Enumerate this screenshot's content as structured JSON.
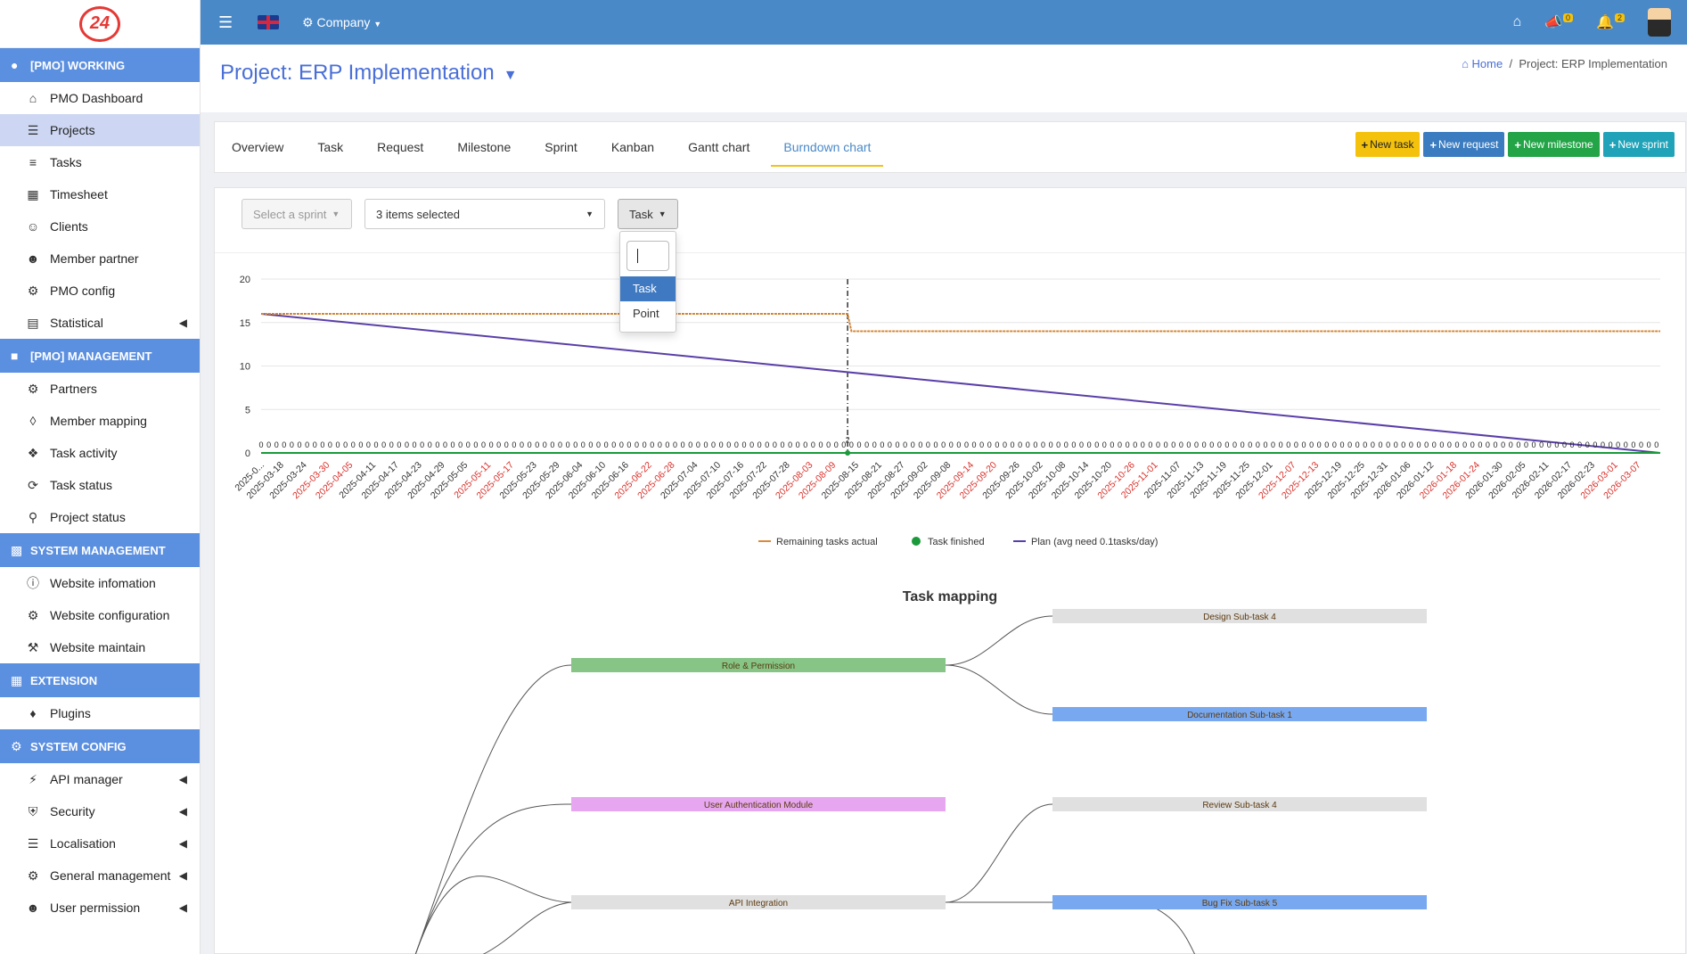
{
  "sidebar": {
    "logo": "24",
    "sections": [
      {
        "title": "[PMO] WORKING",
        "icon": "group-icon",
        "items": [
          {
            "label": "PMO Dashboard",
            "icon": "home-icon"
          },
          {
            "label": "Projects",
            "icon": "layers-icon",
            "active": true
          },
          {
            "label": "Tasks",
            "icon": "list-icon"
          },
          {
            "label": "Timesheet",
            "icon": "grid-icon"
          },
          {
            "label": "Clients",
            "icon": "user-icon"
          },
          {
            "label": "Member partner",
            "icon": "users-icon"
          },
          {
            "label": "PMO config",
            "icon": "gear-icon"
          },
          {
            "label": "Statistical",
            "icon": "chart-icon",
            "chevron": true
          }
        ]
      },
      {
        "title": "[PMO] MANAGEMENT",
        "icon": "building-icon",
        "items": [
          {
            "label": "Partners",
            "icon": "gear-icon"
          },
          {
            "label": "Member mapping",
            "icon": "sitemap-icon"
          },
          {
            "label": "Task activity",
            "icon": "network-icon"
          },
          {
            "label": "Task status",
            "icon": "status-icon"
          },
          {
            "label": "Project status",
            "icon": "pin-icon"
          }
        ]
      },
      {
        "title": "SYSTEM MANAGEMENT",
        "icon": "monitor-icon",
        "items": [
          {
            "label": "Website infomation",
            "icon": "info-icon"
          },
          {
            "label": "Website configuration",
            "icon": "gear-icon"
          },
          {
            "label": "Website maintain",
            "icon": "wrench-icon"
          }
        ]
      },
      {
        "title": "EXTENSION",
        "icon": "grid-icon",
        "items": [
          {
            "label": "Plugins",
            "icon": "puzzle-icon"
          }
        ]
      },
      {
        "title": "SYSTEM CONFIG",
        "icon": "gears-icon",
        "items": [
          {
            "label": "API manager",
            "icon": "plug-icon",
            "chevron": true
          },
          {
            "label": "Security",
            "icon": "shield-icon",
            "chevron": true
          },
          {
            "label": "Localisation",
            "icon": "sign-icon",
            "chevron": true
          },
          {
            "label": "General management",
            "icon": "cog-icon",
            "chevron": true
          },
          {
            "label": "User permission",
            "icon": "users-gear-icon",
            "chevron": true
          }
        ]
      }
    ]
  },
  "topbar": {
    "company": "Company",
    "announcements_count": "0",
    "notifications_count": "2"
  },
  "header": {
    "title": "Project: ERP Implementation",
    "breadcrumb_home": "Home",
    "breadcrumb_current": "Project: ERP Implementation"
  },
  "tabs": [
    "Overview",
    "Task",
    "Request",
    "Milestone",
    "Sprint",
    "Kanban",
    "Gantt chart",
    "Burndown chart"
  ],
  "active_tab": "Burndown chart",
  "actions": {
    "new_task": "New task",
    "new_request": "New request",
    "new_milestone": "New milestone",
    "new_sprint": "New sprint"
  },
  "filters": {
    "sprint_placeholder": "Select a sprint",
    "items_selected": "3 items selected",
    "mode": "Task",
    "options": [
      "Task",
      "Point"
    ]
  },
  "colors": {
    "remaining": "#d88b3a",
    "finished": "#1a9a3a",
    "plan": "#5a3fa8",
    "weekend_label": "#d9312b"
  },
  "chart_data": [
    {
      "type": "line",
      "title": "",
      "xlabel": "",
      "ylabel": "",
      "ylim": [
        0,
        20
      ],
      "yticks": [
        0,
        5,
        10,
        15,
        20
      ],
      "x_start": "2025-03-12",
      "x_end": "2026-03-12",
      "x_tick_labels": [
        "2025-0...",
        "2025-03-18",
        "2025-03-24",
        "2025-03-30",
        "2025-04-05",
        "2025-04-11",
        "2025-04-17",
        "2025-04-23",
        "2025-04-29",
        "2025-05-05",
        "2025-05-11",
        "2025-05-17",
        "2025-05-23",
        "2025-05-29",
        "2025-06-04",
        "2025-06-10",
        "2025-06-16",
        "2025-06-22",
        "2025-06-28",
        "2025-07-04",
        "2025-07-10",
        "2025-07-16",
        "2025-07-22",
        "2025-07-28",
        "2025-08-03",
        "2025-08-09",
        "2025-08-15",
        "2025-08-21",
        "2025-08-27",
        "2025-09-02",
        "2025-09-08",
        "2025-09-14",
        "2025-09-20",
        "2025-09-26",
        "2025-10-02",
        "2025-10-08",
        "2025-10-14",
        "2025-10-20",
        "2025-10-26",
        "2025-11-01",
        "2025-11-07",
        "2025-11-13",
        "2025-11-19",
        "2025-11-25",
        "2025-12-01",
        "2025-12-07",
        "2025-12-13",
        "2025-12-19",
        "2025-12-25",
        "2025-12-31",
        "2026-01-06",
        "2026-01-12",
        "2026-01-18",
        "2026-01-24",
        "2026-01-30",
        "2026-02-05",
        "2026-02-11",
        "2026-02-17",
        "2026-02-23",
        "2026-03-01",
        "2026-03-07"
      ],
      "weekend_ticks": [
        "2025-03-30",
        "2025-04-05",
        "2025-05-11",
        "2025-05-17",
        "2025-06-22",
        "2025-06-28",
        "2025-08-03",
        "2025-08-09",
        "2025-09-14",
        "2025-09-20",
        "2025-10-26",
        "2025-11-01",
        "2025-12-07",
        "2025-12-13",
        "2026-01-18",
        "2026-01-24",
        "2026-03-01",
        "2026-03-07"
      ],
      "today": "2025-08-12",
      "today_label": "2",
      "finished_label": "0",
      "series": [
        {
          "name": "Remaining tasks actual",
          "points": [
            [
              "2025-03-12",
              16
            ],
            [
              "2025-08-12",
              16
            ],
            [
              "2025-08-13",
              14
            ],
            [
              "2026-03-12",
              14
            ]
          ]
        },
        {
          "name": "Task finished",
          "points": [
            [
              "2025-03-12",
              0
            ],
            [
              "2026-03-12",
              0
            ]
          ]
        },
        {
          "name": "Plan (avg need 0.1tasks/day)",
          "points": [
            [
              "2025-03-12",
              16
            ],
            [
              "2026-03-12",
              0
            ]
          ]
        }
      ],
      "legend": "bottom-center",
      "grid": true
    }
  ],
  "mapping": {
    "title": "Task mapping",
    "nodes": [
      {
        "label": "Role & Permission",
        "color": "#86c586"
      },
      {
        "label": "User Authentication Module",
        "color": "#e6a7f0"
      },
      {
        "label": "API Integration",
        "color": "#e0e0e0"
      },
      {
        "label": "Design Sub-task 4",
        "color": "#e0e0e0"
      },
      {
        "label": "Documentation Sub-task 1",
        "color": "#78a9f0"
      },
      {
        "label": "Review Sub-task 4",
        "color": "#e0e0e0"
      },
      {
        "label": "Bug Fix Sub-task 5",
        "color": "#78a9f0"
      }
    ]
  }
}
